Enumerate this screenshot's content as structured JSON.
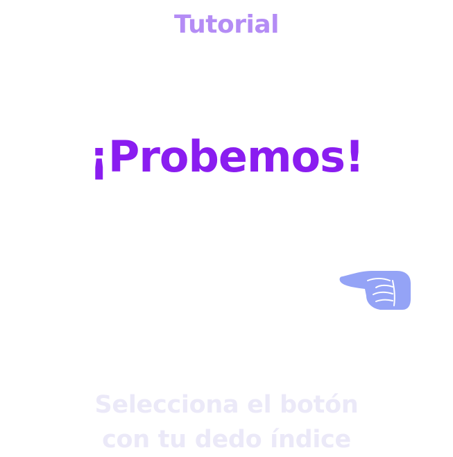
{
  "header": {
    "title": "Tutorial"
  },
  "main": {
    "heading": "¡Probemos!",
    "pointer_icon": "hand-pointing-right-icon",
    "instruction": {
      "line1": "Selecciona el botón",
      "line2": "con tu dedo índice"
    }
  },
  "colors": {
    "header_text": "#b48cf5",
    "heading_text": "#8a1df0",
    "hand_fill": "#94a3f6",
    "instruction_text": "#ebe9f8",
    "background": "#ffffff"
  }
}
